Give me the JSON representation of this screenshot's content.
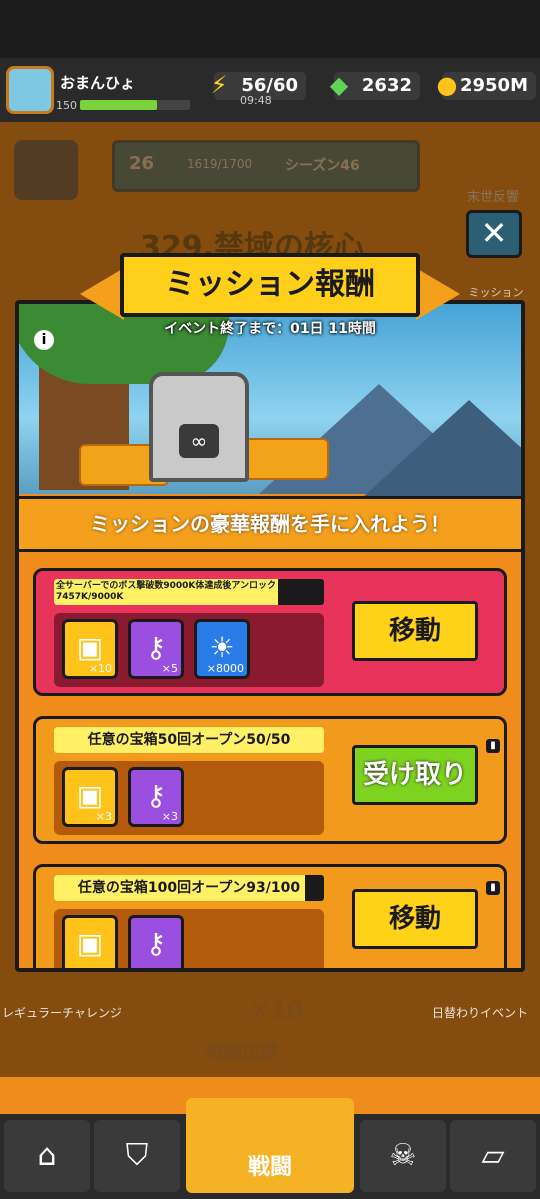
{
  "player": {
    "name": "おまんひょ",
    "level": "150",
    "xp_fraction": 0.7
  },
  "resources": {
    "energy": "56/60",
    "energy_timer": "09:48",
    "gems": "2632",
    "gold": "2950M"
  },
  "season": {
    "level": "26",
    "progress": "1619/1700",
    "label": "シーズン46"
  },
  "background": {
    "stage_title": "329.禁域の核心",
    "right_tab_1": "末世反響",
    "right_tab_2": "ミッション",
    "bottom_left": "レギュラーチャレンジ",
    "bottom_right": "日替わりイベント",
    "energy_cost": "×10",
    "battle_speed": "戦闘加速",
    "nav_battle": "戦闘"
  },
  "modal": {
    "title": "ミッション報酬",
    "event_timer": "イベント終了まで：01日 11時間",
    "headline": "ミッションの豪華報酬を手に入れよう！",
    "close_icon": "close-icon",
    "missions": [
      {
        "text": "全サーバーでのボス撃破数9000K体達成後アンロック7457K/9000K",
        "progress_fraction": 0.83,
        "button": "移動",
        "locked": false,
        "rewards": [
          {
            "icon": "gold-chest-icon",
            "count": "×10"
          },
          {
            "icon": "key-icon",
            "count": "×5"
          },
          {
            "icon": "lion-coin-icon",
            "count": "×8000"
          }
        ]
      },
      {
        "text": "任意の宝箱50回オープン50/50",
        "progress_fraction": 1.0,
        "button": "受け取り",
        "locked": true,
        "rewards": [
          {
            "icon": "gold-chest-icon",
            "count": "×3"
          },
          {
            "icon": "key-icon",
            "count": "×3"
          }
        ]
      },
      {
        "text": "任意の宝箱100回オープン93/100",
        "progress_fraction": 0.93,
        "button": "移動",
        "locked": true,
        "rewards": [
          {
            "icon": "gold-chest-icon",
            "count": ""
          },
          {
            "icon": "key-icon",
            "count": ""
          }
        ]
      }
    ]
  }
}
